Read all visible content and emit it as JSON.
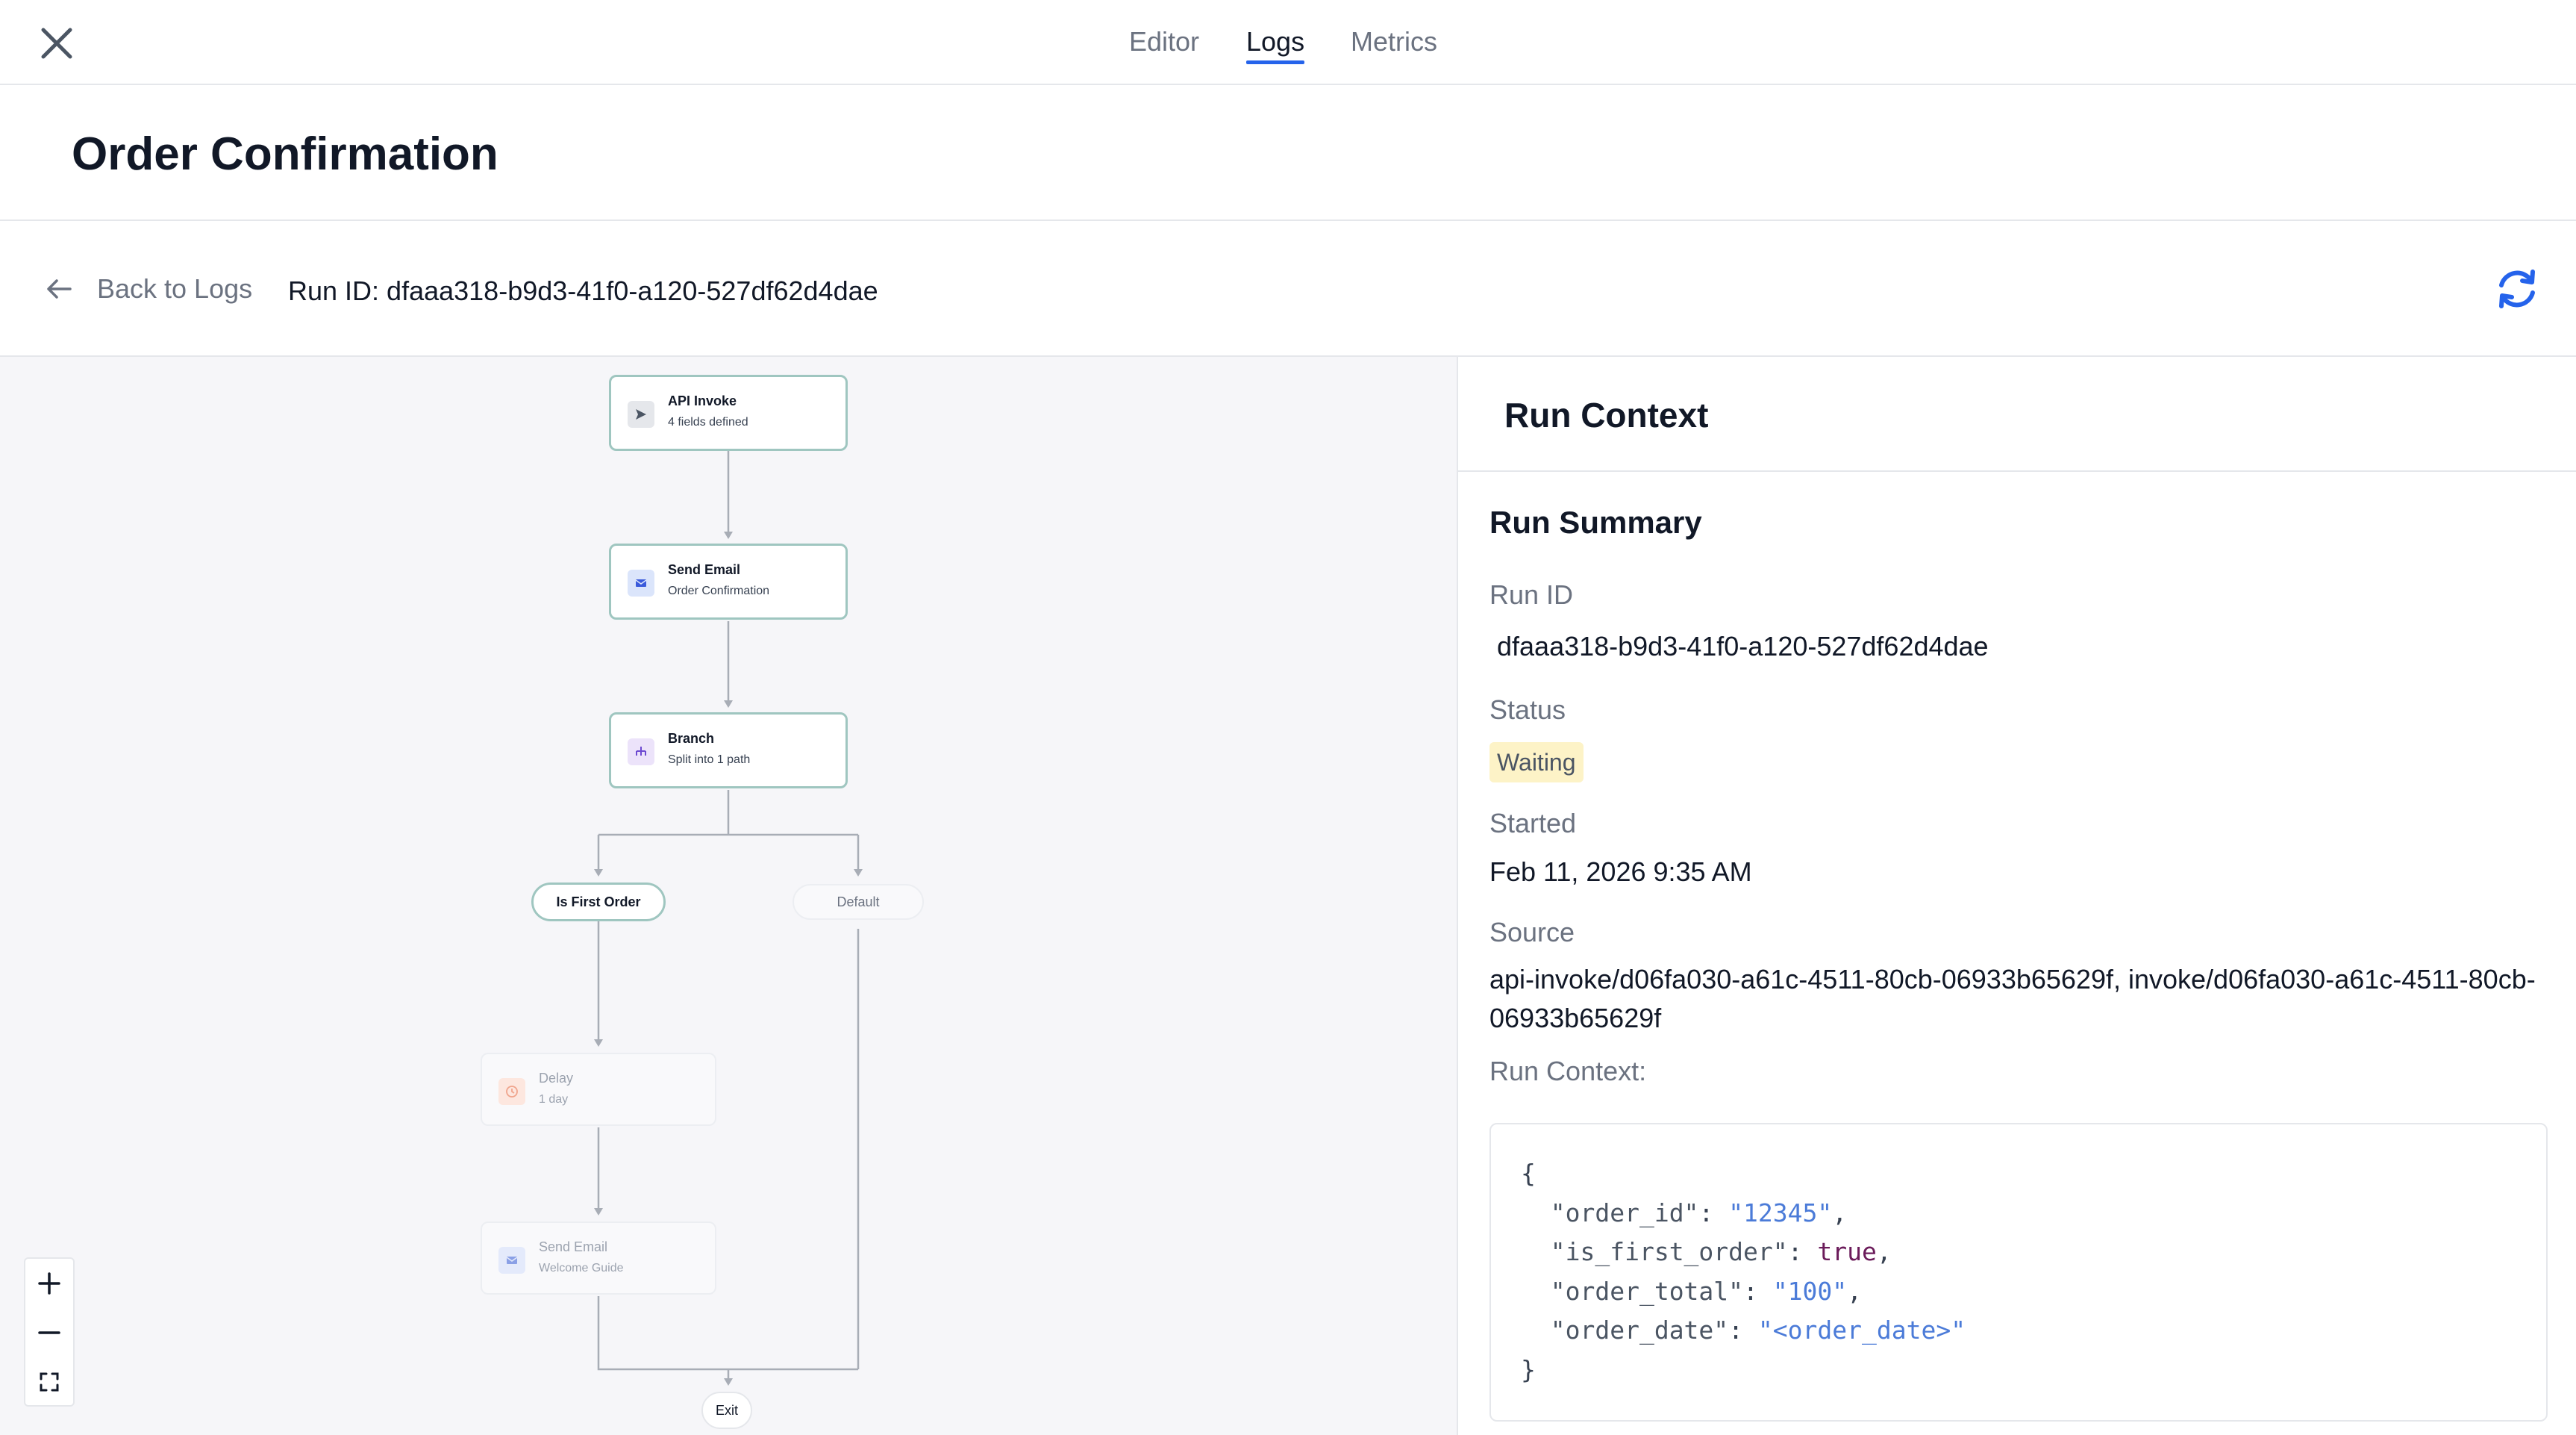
{
  "topbar": {
    "tabs": [
      {
        "label": "Editor",
        "active": false
      },
      {
        "label": "Logs",
        "active": true
      },
      {
        "label": "Metrics",
        "active": false
      }
    ],
    "accent_color": "#2563eb"
  },
  "header": {
    "title": "Order Confirmation"
  },
  "subbar": {
    "back_label": "Back to Logs",
    "run_id_text": "Run ID: dfaaa318-b9d3-41f0-a120-527df62d4dae"
  },
  "workflow": {
    "nodes": [
      {
        "title": "API Invoke",
        "subtitle": "4 fields defined",
        "icon": "send-icon",
        "muted": false
      },
      {
        "title": "Send Email",
        "subtitle": "Order Confirmation",
        "icon": "mail-icon",
        "muted": false
      },
      {
        "title": "Branch",
        "subtitle": "Split into 1 path",
        "icon": "branch-icon",
        "muted": false
      },
      {
        "title": "Delay",
        "subtitle": "1 day",
        "icon": "clock-icon",
        "muted": true
      },
      {
        "title": "Send Email",
        "subtitle": "Welcome Guide",
        "icon": "mail-icon",
        "muted": true
      }
    ],
    "branches": [
      {
        "label": "Is First Order",
        "active": true
      },
      {
        "label": "Default",
        "active": false
      }
    ],
    "exit_label": "Exit",
    "zoom_controls": [
      "zoom-in-icon",
      "zoom-out-icon",
      "fit-view-icon"
    ]
  },
  "panel": {
    "title": "Run Context",
    "summary_title": "Run Summary",
    "run_id_label": "Run ID",
    "run_id_value": "dfaaa318-b9d3-41f0-a120-527df62d4dae",
    "status_label": "Status",
    "status_value": "Waiting",
    "started_label": "Started",
    "started_value": "Feb 11, 2026 9:35 AM",
    "source_label": "Source",
    "source_value": "api-invoke/d06fa030-a61c-4511-80cb-06933b65629f, invoke/d06fa030-a61c-4511-80cb-06933b65629f",
    "context_label": "Run Context:",
    "context_json": {
      "open": "{",
      "close": "}",
      "entries": [
        {
          "key": "\"order_id\"",
          "value": "\"12345\"",
          "type": "string"
        },
        {
          "key": "\"is_first_order\"",
          "value": "true",
          "type": "bool"
        },
        {
          "key": "\"order_total\"",
          "value": "\"100\"",
          "type": "string"
        },
        {
          "key": "\"order_date\"",
          "value": "\"<order_date>\"",
          "type": "string"
        }
      ]
    }
  }
}
